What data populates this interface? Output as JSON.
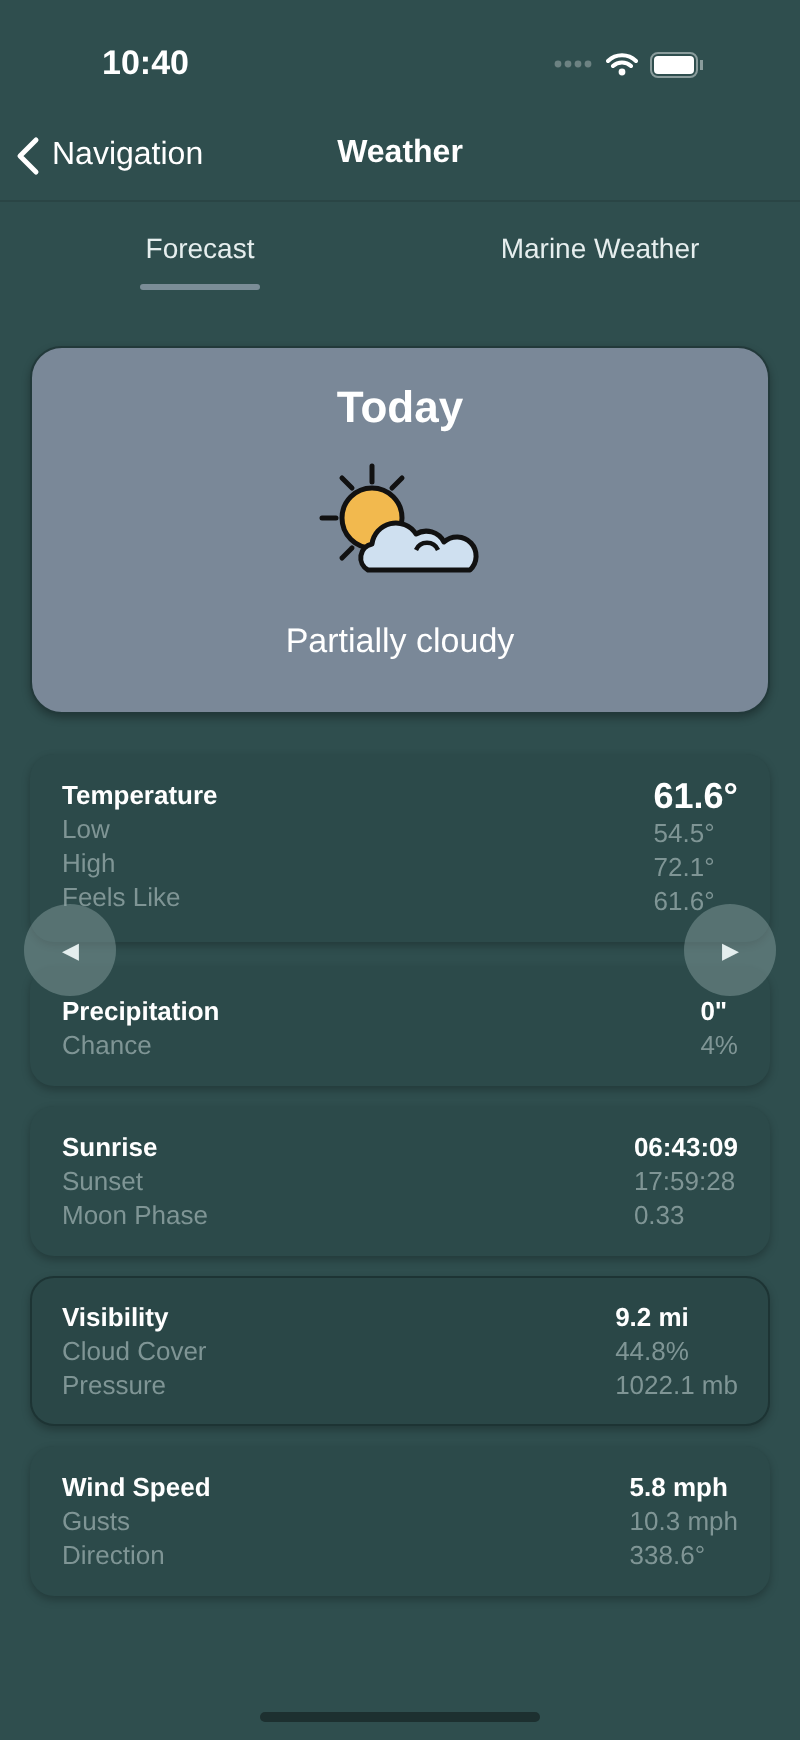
{
  "status_bar": {
    "time": "10:40"
  },
  "nav": {
    "back_label": "Navigation",
    "title": "Weather"
  },
  "tabs": [
    {
      "label": "Forecast",
      "selected": true
    },
    {
      "label": "Marine Weather",
      "selected": false
    }
  ],
  "today": {
    "title": "Today",
    "condition": "Partially cloudy"
  },
  "cards": [
    {
      "selected": false,
      "large_value": true,
      "title": "Temperature",
      "value": "61.6°",
      "rows": [
        {
          "label": "Low",
          "value": "54.5°"
        },
        {
          "label": "High",
          "value": "72.1°"
        },
        {
          "label": "Feels Like",
          "value": "61.6°"
        }
      ]
    },
    {
      "selected": false,
      "large_value": false,
      "title": "Precipitation",
      "value": "0\"",
      "rows": [
        {
          "label": "Chance",
          "value": "4%"
        }
      ]
    },
    {
      "selected": false,
      "large_value": false,
      "title": "Sunrise",
      "value": "06:43:09",
      "rows": [
        {
          "label": "Sunset",
          "value": "17:59:28"
        },
        {
          "label": "Moon Phase",
          "value": "0.33"
        }
      ]
    },
    {
      "selected": true,
      "large_value": false,
      "title": "Visibility",
      "value": "9.2 mi",
      "rows": [
        {
          "label": "Cloud Cover",
          "value": "44.8%"
        },
        {
          "label": "Pressure",
          "value": "1022.1 mb"
        }
      ]
    },
    {
      "selected": false,
      "large_value": false,
      "title": "Wind Speed",
      "value": "5.8 mph",
      "rows": [
        {
          "label": "Gusts",
          "value": "10.3 mph"
        },
        {
          "label": "Direction",
          "value": "338.6°"
        }
      ]
    }
  ],
  "pager": {
    "previous": "◀",
    "next": "▶"
  }
}
